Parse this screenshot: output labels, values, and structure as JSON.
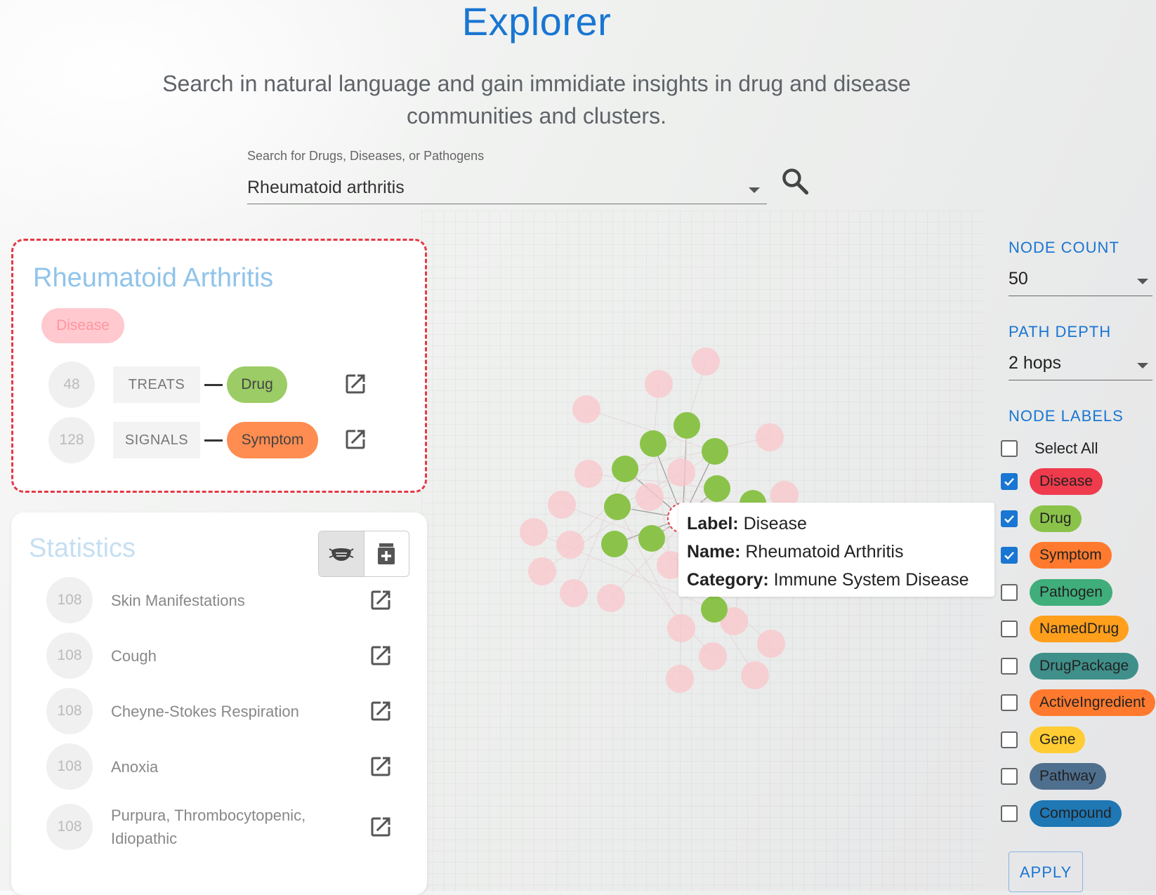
{
  "header": {
    "title": "Explorer",
    "subtitle": "Search in natural language and gain immidiate insights in drug and disease communities and clusters."
  },
  "search": {
    "label": "Search for Drugs, Diseases, or Pathogens",
    "value": "Rheumatoid arthritis"
  },
  "entity_card": {
    "title": "Rheumatoid Arthritis",
    "type_chip": "Disease",
    "relations": [
      {
        "count": "48",
        "relation": "TREATS",
        "target": "Drug",
        "color": "#9ccc65"
      },
      {
        "count": "128",
        "relation": "SIGNALS",
        "target": "Symptom",
        "color": "#ff8c50"
      }
    ]
  },
  "statistics": {
    "title": "Statistics",
    "items": [
      {
        "count": "108",
        "name": "Skin Manifestations"
      },
      {
        "count": "108",
        "name": "Cough"
      },
      {
        "count": "108",
        "name": "Cheyne-Stokes Respiration"
      },
      {
        "count": "108",
        "name": "Anoxia"
      },
      {
        "count": "108",
        "name": "Purpura, Thrombocytopenic, Idiopathic"
      }
    ]
  },
  "controls": {
    "node_count_label": "NODE COUNT",
    "node_count_value": "50",
    "path_depth_label": "PATH DEPTH",
    "path_depth_value": "2 hops",
    "node_labels_label": "NODE LABELS",
    "select_all": "Select All",
    "labels": [
      {
        "name": "Disease",
        "checked": true,
        "color": "#ef3b4c"
      },
      {
        "name": "Drug",
        "checked": true,
        "color": "#8bc34a"
      },
      {
        "name": "Symptom",
        "checked": true,
        "color": "#ff7a2e"
      },
      {
        "name": "Pathogen",
        "checked": false,
        "color": "#3fae7a"
      },
      {
        "name": "NamedDrug",
        "checked": false,
        "color": "#ff9f1c"
      },
      {
        "name": "DrugPackage",
        "checked": false,
        "color": "#3f8f8a"
      },
      {
        "name": "ActiveIngredient",
        "checked": false,
        "color": "#ff7a2e"
      },
      {
        "name": "Gene",
        "checked": false,
        "color": "#ffcc33"
      },
      {
        "name": "Pathway",
        "checked": false,
        "color": "#4f6f8f"
      },
      {
        "name": "Compound",
        "checked": false,
        "color": "#1f77b4"
      }
    ],
    "apply_label": "APPLY"
  },
  "tooltip": {
    "label_key": "Label:",
    "label_value": "Disease",
    "name_key": "Name:",
    "name_value": "Rheumatoid Arthritis",
    "category_key": "Category:",
    "category_value": "Immune System Disease"
  },
  "icons": {
    "search": "search-icon",
    "open": "open-in-new-icon",
    "mask": "mask-icon",
    "medicine": "medicine-box-icon",
    "dropdown": "chevron-down-icon"
  },
  "graph": {
    "node_colors": {
      "drug": "#8bc34a",
      "disease_faded": "#f9c5cb",
      "center_ring": "#e53945"
    }
  }
}
